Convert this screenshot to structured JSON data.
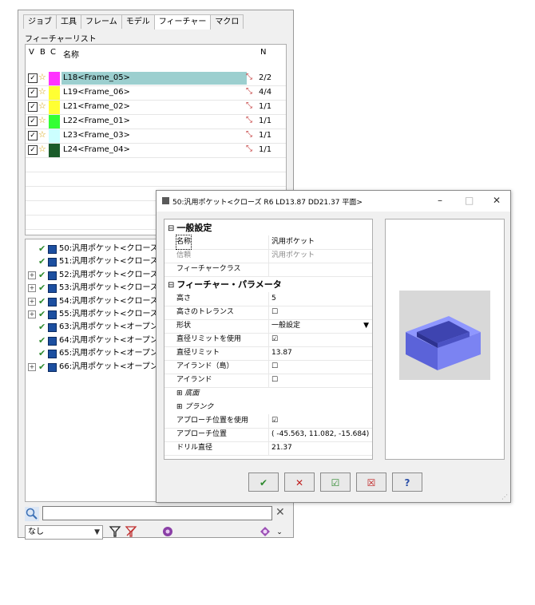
{
  "left_panel": {
    "tabs": [
      "ジョブ",
      "工具",
      "フレーム",
      "モデル",
      "フィーチャー",
      "マクロ"
    ],
    "active_tab": 4,
    "feature_list_label": "フィーチャーリスト",
    "columns": {
      "v": "V",
      "b": "B",
      "c": "C",
      "name": "名称",
      "n": "N"
    },
    "features": [
      {
        "name": "L18<Frame_05>",
        "n": "2/2",
        "color": "#ff33ff",
        "selected": true
      },
      {
        "name": "L19<Frame_06>",
        "n": "4/4",
        "color": "#ffff33",
        "selected": false
      },
      {
        "name": "L21<Frame_02>",
        "n": "1/1",
        "color": "#ffff33",
        "selected": false
      },
      {
        "name": "L22<Frame_01>",
        "n": "1/1",
        "color": "#33ff33",
        "selected": false
      },
      {
        "name": "L23<Frame_03>",
        "n": "1/1",
        "color": "#ccffff",
        "selected": false
      },
      {
        "name": "L24<Frame_04>",
        "n": "1/1",
        "color": "#1a5c2a",
        "selected": false
      }
    ],
    "operations": [
      {
        "label": "50:汎用ポケット<クローズ R6",
        "expandable": false
      },
      {
        "label": "51:汎用ポケット<クローズ R6",
        "expandable": false
      },
      {
        "label": "52:汎用ポケット<クローズ R1",
        "expandable": true
      },
      {
        "label": "53:汎用ポケット<クローズ R6",
        "expandable": true
      },
      {
        "label": "54:汎用ポケット<クローズ R6",
        "expandable": true
      },
      {
        "label": "55:汎用ポケット<クローズ R6",
        "expandable": true
      },
      {
        "label": "63:汎用ポケット<オープン R6",
        "expandable": false
      },
      {
        "label": "64:汎用ポケット<オープン R6",
        "expandable": false
      },
      {
        "label": "65:汎用ポケット<オープン R6",
        "expandable": false
      },
      {
        "label": "66:汎用ポケット<オープン R6",
        "expandable": true
      }
    ],
    "search": {
      "value": "",
      "clear_icon": "✕"
    },
    "filter": {
      "value": "なし"
    }
  },
  "dialog": {
    "title": "50:汎用ポケット<クローズ R6 LD13.87 DD21.37 平面>",
    "controls": {
      "minimize": "–",
      "maximize": "□",
      "close": "✕"
    },
    "sections": {
      "general": "一般設定",
      "params": "フィーチャー・パラメータ"
    },
    "general_rows": [
      {
        "label": "名称",
        "value": "汎用ポケット"
      },
      {
        "label": "信頼",
        "value": "汎用ポケット"
      },
      {
        "label": "フィーチャークラス",
        "value": ""
      }
    ],
    "param_rows": [
      {
        "label": "高さ",
        "value": "5"
      },
      {
        "label": "高さのトレランス",
        "value": "☐"
      },
      {
        "label": "形状",
        "value": "一般設定"
      },
      {
        "label": "直径リミットを使用",
        "value": "☑"
      },
      {
        "label": "直径リミット",
        "value": "13.87"
      },
      {
        "label": "アイランド（島）",
        "value": "☐"
      },
      {
        "label": "アイランド",
        "value": "☐"
      },
      {
        "label": "底面",
        "value": ""
      },
      {
        "label": "ブランク",
        "value": ""
      },
      {
        "label": "アプローチ位置を使用",
        "value": "☑"
      },
      {
        "label": "アプローチ位置",
        "value": "( -45.563, 11.082, -15.684)"
      },
      {
        "label": "ドリル直径",
        "value": "21.37"
      }
    ],
    "buttons": {
      "ok": "✔",
      "cancel": "✕",
      "apply": "☑",
      "delete": "☒",
      "help": "?"
    }
  }
}
